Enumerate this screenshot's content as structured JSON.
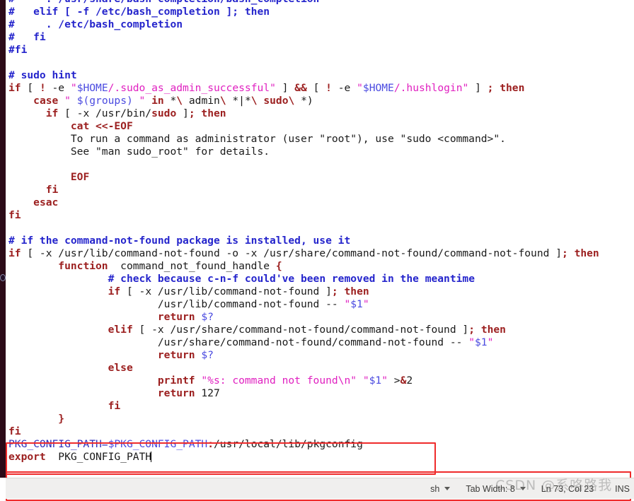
{
  "window": {
    "app": "gedit-text-editor",
    "file_language": "sh"
  },
  "gutter": {
    "marker_icon": "circle-marker-icon"
  },
  "editor": {
    "lines": [
      [
        {
          "t": "#     . /usr/share/bash-completion/bash_completion",
          "c": "cmt"
        }
      ],
      [
        {
          "t": "#   elif [ -f /etc/bash_completion ]; then",
          "c": "cmt"
        }
      ],
      [
        {
          "t": "#     . /etc/bash_completion",
          "c": "cmt"
        }
      ],
      [
        {
          "t": "#   fi",
          "c": "cmt"
        }
      ],
      [
        {
          "t": "#fi",
          "c": "cmt"
        }
      ],
      [
        {
          "t": "",
          "c": "plain"
        }
      ],
      [
        {
          "t": "# sudo hint",
          "c": "cmt"
        }
      ],
      [
        {
          "t": "if",
          "c": "kw"
        },
        {
          "t": " [ ",
          "c": "plain"
        },
        {
          "t": "!",
          "c": "op"
        },
        {
          "t": " -e ",
          "c": "plain"
        },
        {
          "t": "\"",
          "c": "str"
        },
        {
          "t": "$HOME",
          "c": "var"
        },
        {
          "t": "/.sudo_as_admin_successful\"",
          "c": "str"
        },
        {
          "t": " ] ",
          "c": "plain"
        },
        {
          "t": "&&",
          "c": "op"
        },
        {
          "t": " [ ",
          "c": "plain"
        },
        {
          "t": "!",
          "c": "op"
        },
        {
          "t": " -e ",
          "c": "plain"
        },
        {
          "t": "\"",
          "c": "str"
        },
        {
          "t": "$HOME",
          "c": "var"
        },
        {
          "t": "/.hushlogin\"",
          "c": "str"
        },
        {
          "t": " ] ",
          "c": "plain"
        },
        {
          "t": ";",
          "c": "op"
        },
        {
          "t": " ",
          "c": "plain"
        },
        {
          "t": "then",
          "c": "kw"
        }
      ],
      [
        {
          "t": "    ",
          "c": "plain"
        },
        {
          "t": "case",
          "c": "kw"
        },
        {
          "t": " ",
          "c": "plain"
        },
        {
          "t": "\" ",
          "c": "str"
        },
        {
          "t": "$(groups)",
          "c": "var"
        },
        {
          "t": " \"",
          "c": "str"
        },
        {
          "t": " ",
          "c": "plain"
        },
        {
          "t": "in",
          "c": "kw"
        },
        {
          "t": " *",
          "c": "plain"
        },
        {
          "t": "\\",
          "c": "op"
        },
        {
          "t": " admin",
          "c": "plain"
        },
        {
          "t": "\\",
          "c": "op"
        },
        {
          "t": " *|*",
          "c": "plain"
        },
        {
          "t": "\\",
          "c": "op"
        },
        {
          "t": " ",
          "c": "plain"
        },
        {
          "t": "sudo",
          "c": "kw"
        },
        {
          "t": "\\",
          "c": "op"
        },
        {
          "t": " *)",
          "c": "plain"
        }
      ],
      [
        {
          "t": "      ",
          "c": "plain"
        },
        {
          "t": "if",
          "c": "kw"
        },
        {
          "t": " [ -x /usr/bin/",
          "c": "plain"
        },
        {
          "t": "sudo",
          "c": "kw"
        },
        {
          "t": " ]",
          "c": "plain"
        },
        {
          "t": ";",
          "c": "op"
        },
        {
          "t": " ",
          "c": "plain"
        },
        {
          "t": "then",
          "c": "kw"
        }
      ],
      [
        {
          "t": "          ",
          "c": "plain"
        },
        {
          "t": "cat <<-EOF",
          "c": "kw"
        }
      ],
      [
        {
          "t": "          To run a command as administrator (user \"root\"), use \"sudo <command>\".",
          "c": "plain"
        }
      ],
      [
        {
          "t": "          See \"man sudo_root\" for details.",
          "c": "plain"
        }
      ],
      [
        {
          "t": "",
          "c": "plain"
        }
      ],
      [
        {
          "t": "          ",
          "c": "plain"
        },
        {
          "t": "EOF",
          "c": "kw"
        }
      ],
      [
        {
          "t": "      ",
          "c": "plain"
        },
        {
          "t": "fi",
          "c": "kw"
        }
      ],
      [
        {
          "t": "    ",
          "c": "plain"
        },
        {
          "t": "esac",
          "c": "kw"
        }
      ],
      [
        {
          "t": "fi",
          "c": "kw"
        }
      ],
      [
        {
          "t": "",
          "c": "plain"
        }
      ],
      [
        {
          "t": "# if the command-not-found package is installed, use it",
          "c": "cmt"
        }
      ],
      [
        {
          "t": "if",
          "c": "kw"
        },
        {
          "t": " [ -x /usr/lib/command-not-found -o -x /usr/share/command-not-found/command-not-found ]",
          "c": "plain"
        },
        {
          "t": ";",
          "c": "op"
        },
        {
          "t": " ",
          "c": "plain"
        },
        {
          "t": "then",
          "c": "kw"
        }
      ],
      [
        {
          "t": "        ",
          "c": "plain"
        },
        {
          "t": "function",
          "c": "kw"
        },
        {
          "t": "  command_not_found_handle ",
          "c": "plain"
        },
        {
          "t": "{",
          "c": "kw"
        }
      ],
      [
        {
          "t": "                ",
          "c": "plain"
        },
        {
          "t": "# check because c-n-f could've been removed in the meantime",
          "c": "cmt"
        }
      ],
      [
        {
          "t": "                ",
          "c": "plain"
        },
        {
          "t": "if",
          "c": "kw"
        },
        {
          "t": " [ -x /usr/lib/command-not-found ]",
          "c": "plain"
        },
        {
          "t": ";",
          "c": "op"
        },
        {
          "t": " ",
          "c": "plain"
        },
        {
          "t": "then",
          "c": "kw"
        }
      ],
      [
        {
          "t": "                        /usr/lib/command-not-found -- ",
          "c": "plain"
        },
        {
          "t": "\"",
          "c": "str"
        },
        {
          "t": "$1",
          "c": "var"
        },
        {
          "t": "\"",
          "c": "str"
        }
      ],
      [
        {
          "t": "                        ",
          "c": "plain"
        },
        {
          "t": "return",
          "c": "kw"
        },
        {
          "t": " ",
          "c": "plain"
        },
        {
          "t": "$?",
          "c": "var"
        }
      ],
      [
        {
          "t": "                ",
          "c": "plain"
        },
        {
          "t": "elif",
          "c": "kw"
        },
        {
          "t": " [ -x /usr/share/command-not-found/command-not-found ]",
          "c": "plain"
        },
        {
          "t": ";",
          "c": "op"
        },
        {
          "t": " ",
          "c": "plain"
        },
        {
          "t": "then",
          "c": "kw"
        }
      ],
      [
        {
          "t": "                        /usr/share/command-not-found/command-not-found -- ",
          "c": "plain"
        },
        {
          "t": "\"",
          "c": "str"
        },
        {
          "t": "$1",
          "c": "var"
        },
        {
          "t": "\"",
          "c": "str"
        }
      ],
      [
        {
          "t": "                        ",
          "c": "plain"
        },
        {
          "t": "return",
          "c": "kw"
        },
        {
          "t": " ",
          "c": "plain"
        },
        {
          "t": "$?",
          "c": "var"
        }
      ],
      [
        {
          "t": "                ",
          "c": "plain"
        },
        {
          "t": "else",
          "c": "kw"
        }
      ],
      [
        {
          "t": "                        ",
          "c": "plain"
        },
        {
          "t": "printf",
          "c": "kw"
        },
        {
          "t": " ",
          "c": "plain"
        },
        {
          "t": "\"%s: command not found\\n\"",
          "c": "str"
        },
        {
          "t": " ",
          "c": "plain"
        },
        {
          "t": "\"",
          "c": "str"
        },
        {
          "t": "$1",
          "c": "var"
        },
        {
          "t": "\"",
          "c": "str"
        },
        {
          "t": " >",
          "c": "plain"
        },
        {
          "t": "&",
          "c": "op"
        },
        {
          "t": "2",
          "c": "plain"
        }
      ],
      [
        {
          "t": "                        ",
          "c": "plain"
        },
        {
          "t": "return",
          "c": "kw"
        },
        {
          "t": " 127",
          "c": "plain"
        }
      ],
      [
        {
          "t": "                ",
          "c": "plain"
        },
        {
          "t": "fi",
          "c": "kw"
        }
      ],
      [
        {
          "t": "        ",
          "c": "plain"
        },
        {
          "t": "}",
          "c": "kw"
        }
      ],
      [
        {
          "t": "fi",
          "c": "kw"
        }
      ],
      [
        {
          "t": "PKG_CONFIG_PATH",
          "c": "bvar"
        },
        {
          "t": "=",
          "c": "bvar"
        },
        {
          "t": "$PKG_CONFIG_PATH",
          "c": "var"
        },
        {
          "t": ":",
          "c": "op"
        },
        {
          "t": "/usr/local/lib/pkgconfig",
          "c": "plain"
        }
      ],
      [
        {
          "t": "export",
          "c": "kw"
        },
        {
          "t": "  PKG_CONFIG_PATH",
          "c": "plain"
        },
        {
          "t": "|CARET|",
          "c": "caret"
        }
      ]
    ]
  },
  "annotations": {
    "env_box_color": "#ef2b2b",
    "status_box_color": "#ef2b2b"
  },
  "statusbar": {
    "language_label": "sh",
    "tab_width_label": "Tab Width: 8",
    "position_label": "Ln 73, Col 23",
    "insert_mode_label": "INS",
    "language_chevron": "chevron-down-icon",
    "tab_width_chevron": "chevron-down-icon"
  },
  "watermark": {
    "text": "CSDN @系咯路我"
  }
}
